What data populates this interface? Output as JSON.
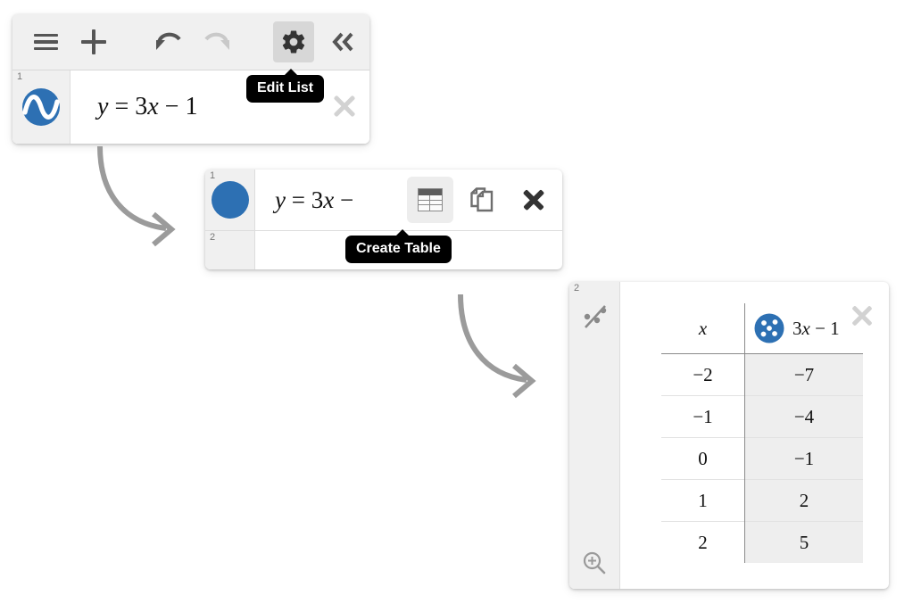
{
  "panel_one": {
    "toolbar": {
      "menu_label": "menu",
      "add_label": "add",
      "undo_label": "undo",
      "redo_label": "redo",
      "gear_label": "settings",
      "collapse_label": "collapse"
    },
    "row": {
      "index": "1",
      "icon": "sine-wave-dot-icon",
      "expression_lhs": "y",
      "expression_eq": "= 3",
      "expression_var": "x",
      "expression_rhs": "− 1",
      "expression_full": "y = 3x − 1",
      "close_label": "✕"
    },
    "tooltip": "Edit List"
  },
  "panel_two": {
    "row_one": {
      "index": "1",
      "icon": "blue-circle-dot-icon",
      "expression_lhs": "y",
      "expression_eq": "= 3",
      "expression_var": "x",
      "expression_rhs": "−",
      "expression_full": "y = 3x −"
    },
    "row_two": {
      "index": "2"
    },
    "actions": {
      "table_label": "create-table",
      "duplicate_label": "duplicate",
      "close_label": "✕"
    },
    "tooltip": "Create Table"
  },
  "panel_three": {
    "index": "2",
    "gutter_icon": "scatter-plot-icon",
    "zoom_fit_icon": "zoom-fit-icon",
    "close_label": "✕",
    "table": {
      "header_x": "x",
      "header_y_icon": "blue-dots-circle-icon",
      "header_y_coef": "3",
      "header_y_var": "x",
      "header_y_rest": "− 1",
      "header_y_text": "3x − 1",
      "rows": [
        {
          "x": "−2",
          "y": "−7"
        },
        {
          "x": "−1",
          "y": "−4"
        },
        {
          "x": "0",
          "y": "−1"
        },
        {
          "x": "1",
          "y": "2"
        },
        {
          "x": "2",
          "y": "5"
        }
      ]
    }
  },
  "colors": {
    "brand_blue": "#2d70b3",
    "toolbar_bg": "#f0f0f0",
    "tooltip_bg": "#000000",
    "arrow_gray": "#9b9b9b",
    "column_shade": "#eeeeee"
  }
}
